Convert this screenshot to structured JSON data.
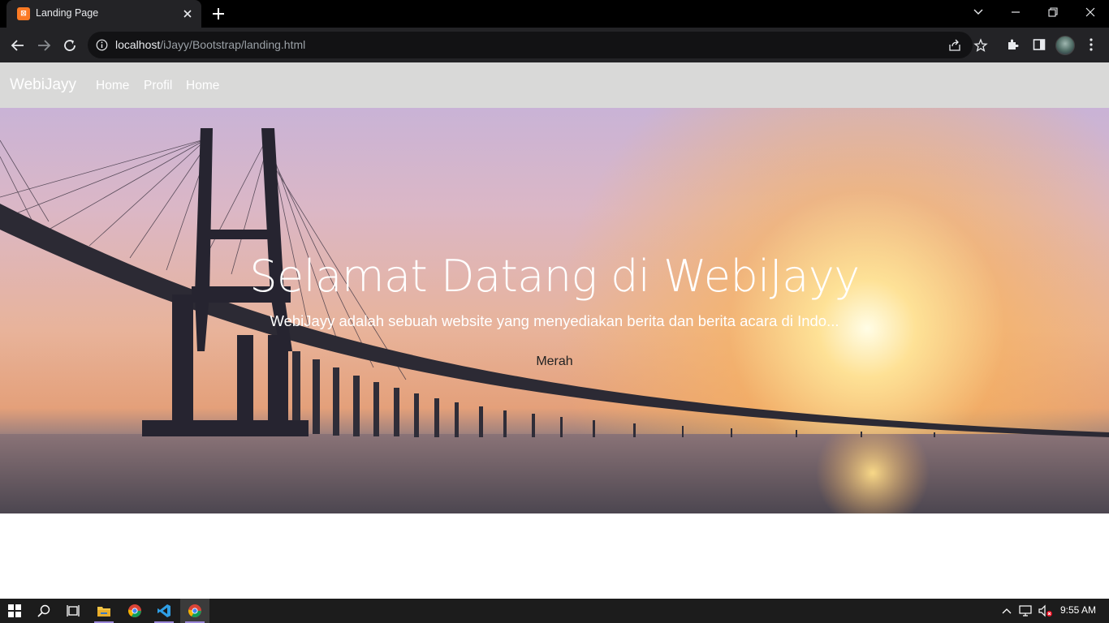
{
  "browser": {
    "tab": {
      "title": "Landing Page",
      "favicon_icon": "xampp-icon",
      "favicon_color": "#fb7a24"
    },
    "url": {
      "host": "localhost",
      "path": "/iJayy/Bootstrap/landing.html"
    },
    "icons": [
      "back-icon",
      "forward-icon",
      "reload-icon",
      "info-icon",
      "share-icon",
      "star-icon",
      "extensions-icon",
      "side-panel-icon",
      "avatar",
      "menu-icon",
      "minimize-icon",
      "restore-icon",
      "close-icon",
      "tab-search-icon"
    ]
  },
  "page": {
    "navbar": {
      "brand": "WebiJayy",
      "links": [
        {
          "label": "Home"
        },
        {
          "label": "Profil"
        },
        {
          "label": "Home"
        }
      ],
      "background": "#d9d9d8"
    },
    "hero": {
      "title": "Selamat Datang di WebiJayy",
      "subtitle": "WebiJayy adalah sebuah website yang menyediakan berita dan berita acara di Indo...",
      "button_label": "Merah"
    }
  },
  "taskbar": {
    "apps": [
      "start-icon",
      "search-icon",
      "task-view-icon",
      "file-explorer-icon",
      "chrome-icon",
      "vscode-icon",
      "chrome-active-icon"
    ],
    "tray_icons": [
      "chevron-up-icon",
      "network-icon",
      "volume-muted-icon"
    ],
    "time": "9:55 AM"
  }
}
